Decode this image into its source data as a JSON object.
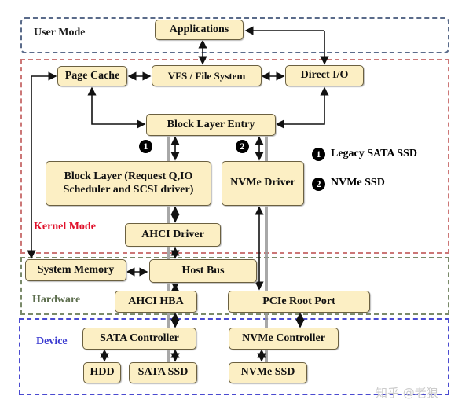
{
  "regions": {
    "user": "User Mode",
    "kernel": "Kernel Mode",
    "hardware": "Hardware",
    "device": "Device"
  },
  "colors": {
    "user": "#5a6b8a",
    "kernel": "#c0504d",
    "kernel_text": "#e0102a",
    "hardware": "#6b7a5a",
    "device": "#3a3ad0",
    "box_fill": "#fcefc4"
  },
  "boxes": {
    "applications": "Applications",
    "page_cache": "Page Cache",
    "vfs": "VFS / File System",
    "direct_io": "Direct I/O",
    "block_entry": "Block Layer Entry",
    "block_layer_1": "Block Layer (Request Q,IO",
    "block_layer_2": "Scheduler and SCSI driver)",
    "nvme_driver": "NVMe Driver",
    "ahci_driver": "AHCI Driver",
    "system_memory": "System Memory",
    "host_bus": "Host Bus",
    "ahci_hba": "AHCI HBA",
    "pcie_root": "PCIe Root Port",
    "sata_controller": "SATA Controller",
    "nvme_controller": "NVMe Controller",
    "hdd": "HDD",
    "sata_ssd": "SATA SSD",
    "nvme_ssd": "NVMe SSD"
  },
  "markers": {
    "one": "1",
    "two": "2"
  },
  "legend": [
    {
      "num": "1",
      "label": "Legacy SATA SSD"
    },
    {
      "num": "2",
      "label": "NVMe SSD"
    }
  ],
  "watermark": "知乎 @老狼"
}
